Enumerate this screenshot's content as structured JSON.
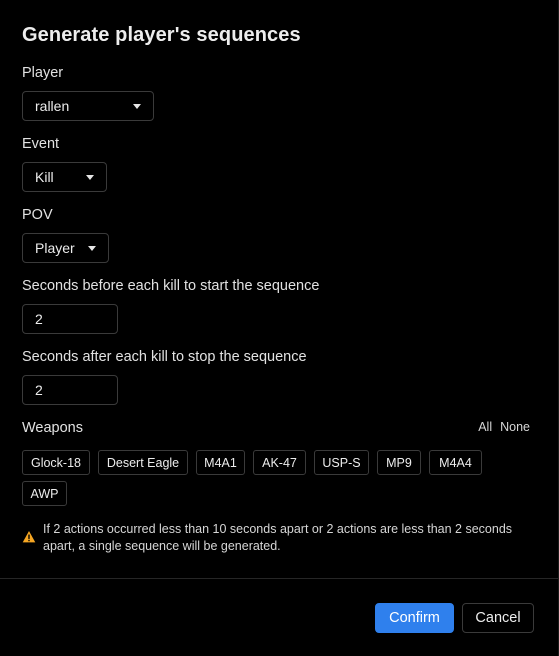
{
  "dialog": {
    "title": "Generate player's sequences"
  },
  "player": {
    "label": "Player",
    "value": "rallen"
  },
  "event": {
    "label": "Event",
    "value": "Kill"
  },
  "pov": {
    "label": "POV",
    "value": "Player"
  },
  "seconds_before": {
    "label": "Seconds before each kill to start the sequence",
    "value": "2"
  },
  "seconds_after": {
    "label": "Seconds after each kill to stop the sequence",
    "value": "2"
  },
  "weapons": {
    "label": "Weapons",
    "all_label": "All",
    "none_label": "None",
    "items": [
      "Glock-18",
      "Desert Eagle",
      "M4A1",
      "AK-47",
      "USP-S",
      "MP9",
      "M4A4",
      "AWP"
    ]
  },
  "warning": {
    "icon": "warning-triangle-icon",
    "color": "#f5a623",
    "text": "If 2 actions occurred less than 10 seconds apart or 2 actions are less than 2 seconds apart, a single sequence will be generated."
  },
  "footer": {
    "confirm_label": "Confirm",
    "cancel_label": "Cancel",
    "accent_color": "#2f80ed"
  }
}
